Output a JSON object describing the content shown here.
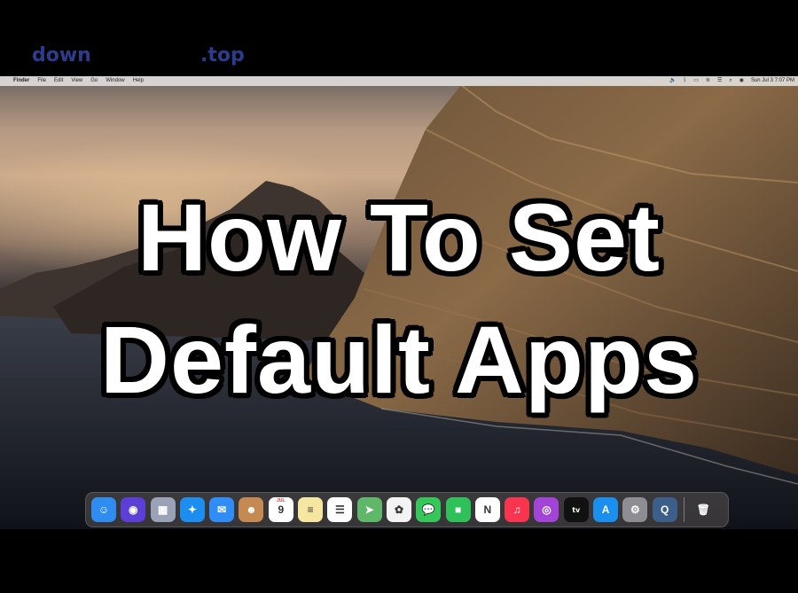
{
  "watermark": {
    "part1": "down",
    "part2": ".top"
  },
  "menubar": {
    "apple_glyph": "",
    "items": [
      "Finder",
      "File",
      "Edit",
      "View",
      "Go",
      "Window",
      "Help"
    ],
    "clock": "Sun Jul 3  7:07 PM"
  },
  "headline": {
    "line1": "How To Set",
    "line2": "Default Apps"
  },
  "dock": {
    "apps": [
      {
        "name": "finder-icon",
        "color": "#2f8cf0",
        "glyph": "☺"
      },
      {
        "name": "siri-icon",
        "color": "#5b3fd6",
        "glyph": "◉"
      },
      {
        "name": "launchpad-icon",
        "color": "#9aa3b5",
        "glyph": "▦"
      },
      {
        "name": "safari-icon",
        "color": "#1c8ef0",
        "glyph": "✦"
      },
      {
        "name": "mail-icon",
        "color": "#2f8df5",
        "glyph": "✉"
      },
      {
        "name": "contacts-icon",
        "color": "#c48a52",
        "glyph": "☻"
      },
      {
        "name": "calendar-icon",
        "color": "#ffffff",
        "glyph": "9",
        "month": "JUL"
      },
      {
        "name": "notes-icon",
        "color": "#f5e7a0",
        "glyph": "≡"
      },
      {
        "name": "reminders-icon",
        "color": "#ffffff",
        "glyph": "☰"
      },
      {
        "name": "maps-icon",
        "color": "#5fb86a",
        "glyph": "➤"
      },
      {
        "name": "photos-icon",
        "color": "#f3f3f3",
        "glyph": "✿"
      },
      {
        "name": "messages-icon",
        "color": "#34c759",
        "glyph": "💬"
      },
      {
        "name": "facetime-icon",
        "color": "#2ec15a",
        "glyph": "■"
      },
      {
        "name": "news-icon",
        "color": "#ffffff",
        "glyph": "N"
      },
      {
        "name": "music-icon",
        "color": "#f8344f",
        "glyph": "♫"
      },
      {
        "name": "podcasts-icon",
        "color": "#a244d8",
        "glyph": "◎"
      },
      {
        "name": "apple-tv-icon",
        "color": "#111111",
        "glyph": "tv"
      },
      {
        "name": "app-store-icon",
        "color": "#1b8ff0",
        "glyph": "A"
      },
      {
        "name": "system-preferences-icon",
        "color": "#8d8d93",
        "glyph": "⚙"
      },
      {
        "name": "quicktime-icon",
        "color": "#3b5f8a",
        "glyph": "Q"
      }
    ],
    "trash": {
      "name": "trash-icon",
      "color": "#9a9a9a",
      "glyph": "🗑"
    }
  }
}
